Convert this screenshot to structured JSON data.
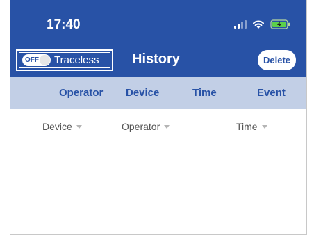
{
  "status_bar": {
    "time": "17:40"
  },
  "header": {
    "toggle": {
      "state_label": "OFF",
      "label": "Traceless"
    },
    "title": "History",
    "delete_label": "Delete",
    "accent_color": "#2852a6"
  },
  "columns": [
    "Operator",
    "Device",
    "Time",
    "Event"
  ],
  "filters": [
    {
      "label": "Device"
    },
    {
      "label": "Operator"
    },
    {
      "label": "Time"
    }
  ],
  "icons": [
    "signal-icon",
    "wifi-icon",
    "battery-charging-icon",
    "chevron-down-icon"
  ]
}
